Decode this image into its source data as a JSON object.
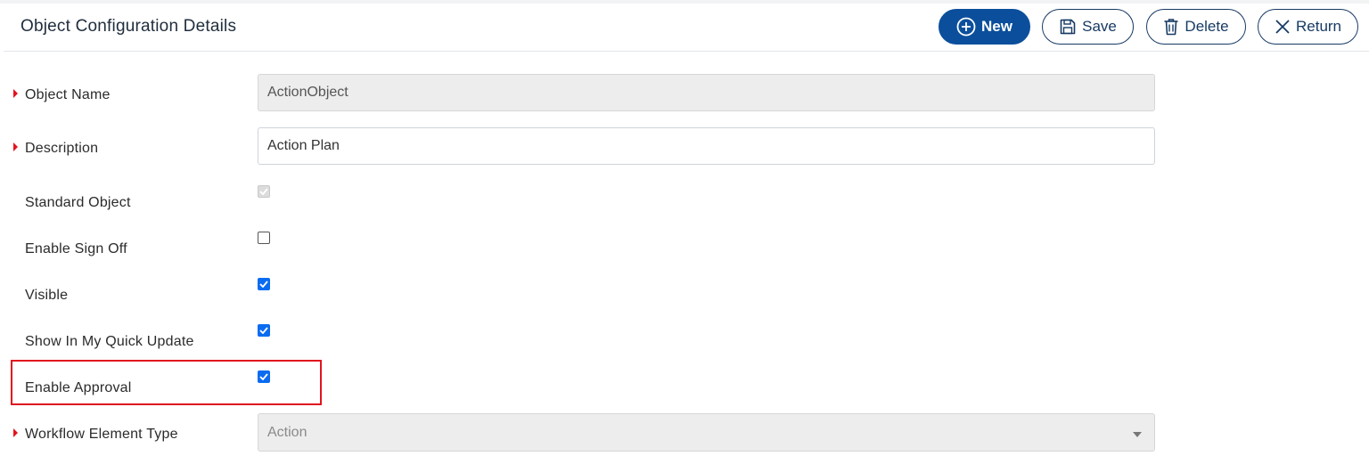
{
  "header": {
    "title": "Object Configuration Details",
    "buttons": {
      "new_label": "New",
      "save_label": "Save",
      "delete_label": "Delete",
      "return_label": "Return"
    }
  },
  "form": {
    "object_name": {
      "label": "Object Name",
      "value": "ActionObject",
      "required": true,
      "disabled": true
    },
    "description": {
      "label": "Description",
      "value": "Action Plan",
      "required": true
    },
    "standard_object": {
      "label": "Standard Object",
      "checked": true,
      "disabled": true
    },
    "enable_sign_off": {
      "label": "Enable Sign Off",
      "checked": false
    },
    "visible": {
      "label": "Visible",
      "checked": true
    },
    "show_in_my_quick_update": {
      "label": "Show In My Quick Update",
      "checked": true
    },
    "enable_approval": {
      "label": "Enable Approval",
      "checked": true,
      "highlighted": true
    },
    "workflow_element_type": {
      "label": "Workflow Element Type",
      "value": "Action",
      "required": true,
      "disabled": true
    }
  },
  "colors": {
    "primary": "#0b4f9c",
    "outline_button": "#173a63",
    "required_marker": "#e0141e",
    "checkbox_checked": "#0b6cf0",
    "highlight": "#e0141e"
  }
}
